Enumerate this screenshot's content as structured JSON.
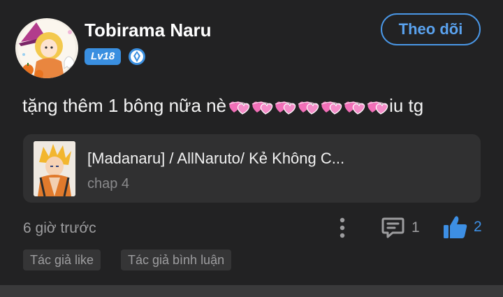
{
  "user": {
    "name": "Tobirama Naru",
    "level": "Lv18",
    "follow_label": "Theo dõi"
  },
  "comment": {
    "text": "tặng thêm 1 bông nữa nè",
    "heart_count": 7,
    "suffix": "iu tg"
  },
  "story": {
    "title": "[Madanaru] / AllNaruto/ Kẻ Không C...",
    "chapter": "chap 4"
  },
  "meta": {
    "time": "6 giờ trước",
    "comment_count": "1",
    "like_count": "2"
  },
  "tags": [
    "Tác giả like",
    "Tác giả bình luận"
  ],
  "colors": {
    "accent": "#3d8fe4",
    "background": "#222223",
    "card": "#303031",
    "muted": "#9d9d9f"
  },
  "icons": {
    "verify": "verified-badge-icon",
    "heart": "pink-hearts-icon",
    "more": "more-vertical-icon",
    "comment": "comment-icon",
    "like": "thumbs-up-icon"
  }
}
